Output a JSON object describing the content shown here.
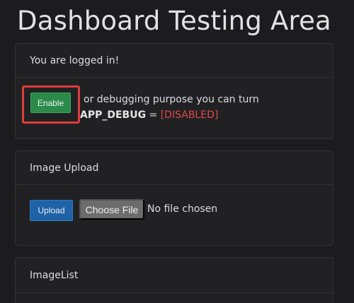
{
  "page": {
    "title": "Dashboard Testing Area"
  },
  "login_card": {
    "header": "You are logged in!",
    "enable_button": "Enable",
    "debug_text_line1": "or debugging purpose you can turn",
    "debug_key": "APP_DEBUG",
    "debug_equals": "=",
    "debug_status": "[DISABLED]"
  },
  "upload_card": {
    "header": "Image Upload",
    "upload_button": "Upload",
    "choose_file_button": "Choose File",
    "file_status": "No file chosen"
  },
  "image_list_card": {
    "header": "ImageList"
  },
  "colors": {
    "background": "#1c1c1e",
    "enable_button": "#2b8a49",
    "upload_button": "#1f62a6",
    "disabled_status": "#e04848",
    "highlight": "#e03c3c"
  }
}
